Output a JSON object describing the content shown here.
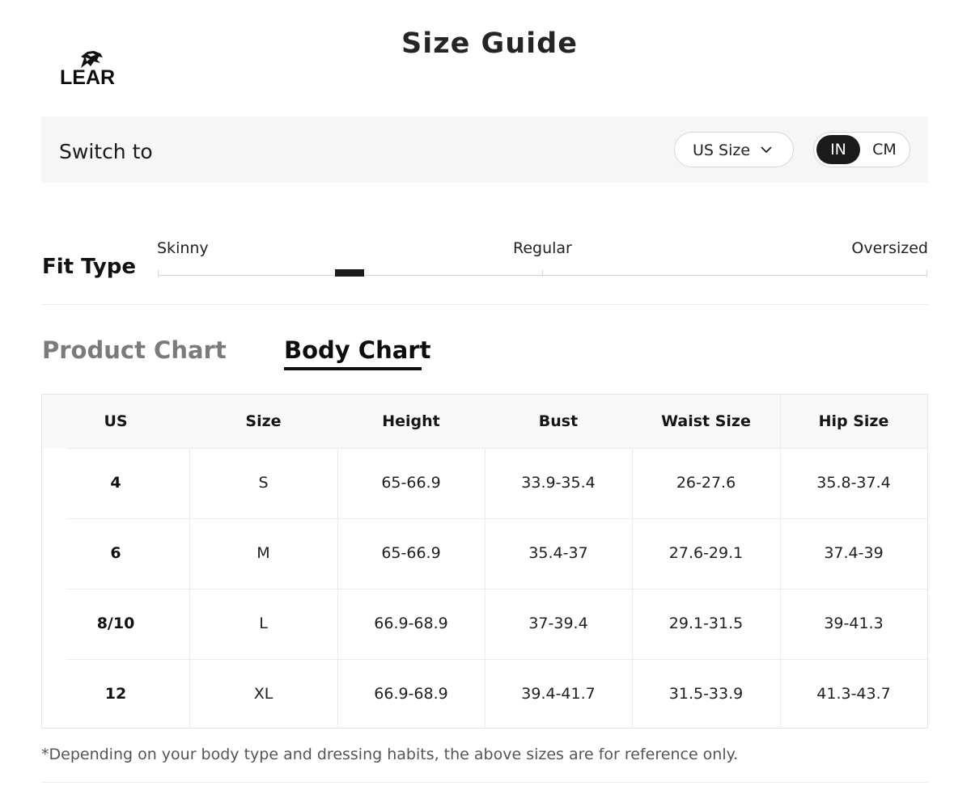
{
  "header": {
    "brand": "LEAR",
    "title": "Size Guide"
  },
  "switch_bar": {
    "label": "Switch to",
    "size_system": "US Size",
    "units": [
      "IN",
      "CM"
    ],
    "selected_unit": "IN"
  },
  "fit": {
    "title": "Fit Type",
    "labels": [
      "Skinny",
      "Regular",
      "Oversized"
    ],
    "level": 0.23
  },
  "tabs": {
    "items": [
      "Product Chart",
      "Body Chart"
    ],
    "active": "Body Chart"
  },
  "table": {
    "headers": [
      "US",
      "Size",
      "Height",
      "Bust",
      "Waist Size",
      "Hip Size"
    ],
    "rows": [
      [
        "4",
        "S",
        "65-66.9",
        "33.9-35.4",
        "26-27.6",
        "35.8-37.4"
      ],
      [
        "6",
        "M",
        "65-66.9",
        "35.4-37",
        "27.6-29.1",
        "37.4-39"
      ],
      [
        "8/10",
        "L",
        "66.9-68.9",
        "37-39.4",
        "29.1-31.5",
        "39-41.3"
      ],
      [
        "12",
        "XL",
        "66.9-68.9",
        "39.4-41.7",
        "31.5-33.9",
        "41.3-43.7"
      ]
    ]
  },
  "footnote": "*Depending on your body type and dressing habits, the above sizes are for reference only."
}
